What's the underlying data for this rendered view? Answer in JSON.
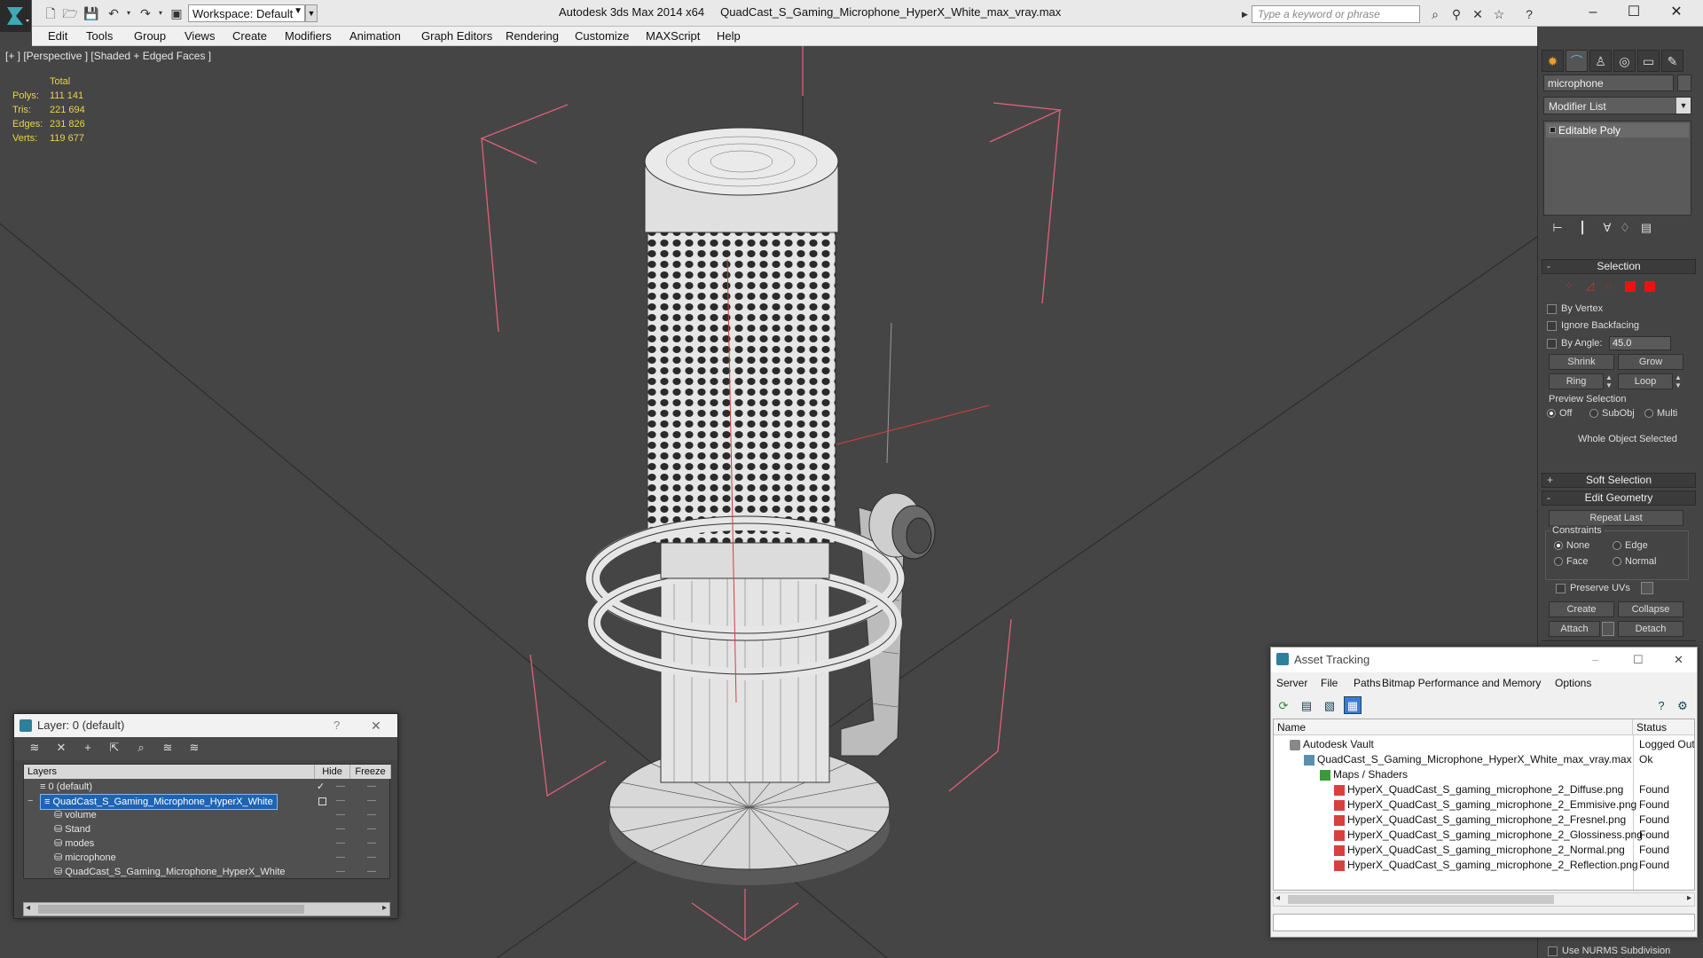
{
  "titlebar": {
    "workspace": "Workspace: Default",
    "app": "Autodesk 3ds Max  2014 x64",
    "file": "QuadCast_S_Gaming_Microphone_HyperX_White_max_vray.max",
    "search_placeholder": "Type a keyword or phrase"
  },
  "menus": [
    "Edit",
    "Tools",
    "Group",
    "Views",
    "Create",
    "Modifiers",
    "Animation",
    "Graph Editors",
    "Rendering",
    "Customize",
    "MAXScript",
    "Help"
  ],
  "viewport": {
    "label": "[+ ] [Perspective ] [Shaded + Edged Faces ]",
    "stats_header": "Total",
    "stats": [
      {
        "k": "Polys:",
        "v": "111 141"
      },
      {
        "k": "Tris:",
        "v": "221 694"
      },
      {
        "k": "Edges:",
        "v": "231 826"
      },
      {
        "k": "Verts:",
        "v": "119 677"
      }
    ],
    "stats_color": "#e8d44a",
    "bracket_color": "#e0607a"
  },
  "command_panel": {
    "object_name": "microphone",
    "modifier_list": "Modifier List",
    "stack_item": "Editable Poly",
    "selection": {
      "title": "Selection",
      "by_vertex": "By Vertex",
      "ignore_backfacing": "Ignore Backfacing",
      "by_angle": "By Angle:",
      "angle_value": "45.0",
      "shrink": "Shrink",
      "grow": "Grow",
      "ring": "Ring",
      "loop": "Loop",
      "preview_label": "Preview Selection",
      "preview_off": "Off",
      "preview_subobj": "SubObj",
      "preview_multi": "Multi",
      "status": "Whole Object Selected"
    },
    "soft_selection": "Soft Selection",
    "edit_geometry": {
      "title": "Edit Geometry",
      "repeat_last": "Repeat Last",
      "constraints": "Constraints",
      "none": "None",
      "edge": "Edge",
      "face": "Face",
      "normal": "Normal",
      "preserve_uvs": "Preserve UVs",
      "create": "Create",
      "collapse": "Collapse",
      "attach": "Attach",
      "detach": "Detach"
    },
    "nurms": "Use NURMS Subdivision"
  },
  "layer_dialog": {
    "title": "Layer: 0 (default)",
    "help": "?",
    "columns": {
      "layers": "Layers",
      "hide": "Hide",
      "freeze": "Freeze"
    },
    "rows": [
      {
        "name": "0 (default)",
        "indent": 1,
        "checked": true
      },
      {
        "name": "QuadCast_S_Gaming_Microphone_HyperX_White",
        "indent": 1,
        "selected": true
      },
      {
        "name": "volume",
        "indent": 2
      },
      {
        "name": "Stand",
        "indent": 2
      },
      {
        "name": "modes",
        "indent": 2
      },
      {
        "name": "microphone",
        "indent": 2
      },
      {
        "name": "QuadCast_S_Gaming_Microphone_HyperX_White",
        "indent": 2
      }
    ]
  },
  "asset_dialog": {
    "title": "Asset Tracking",
    "menu": [
      "Server",
      "File",
      "Paths",
      "Bitmap Performance and Memory",
      "Options"
    ],
    "columns": {
      "name": "Name",
      "status": "Status"
    },
    "rows": [
      {
        "name": "Autodesk Vault",
        "status": "Logged Out",
        "level": 0,
        "icon": "vault-icon"
      },
      {
        "name": "QuadCast_S_Gaming_Microphone_HyperX_White_max_vray.max",
        "status": "Ok",
        "level": 1,
        "icon": "max-file-icon"
      },
      {
        "name": "Maps / Shaders",
        "status": "",
        "level": 2,
        "icon": "maps-folder-icon"
      },
      {
        "name": "HyperX_QuadCast_S_gaming_microphone_2_Diffuse.png",
        "status": "Found",
        "level": 3,
        "icon": "png-icon"
      },
      {
        "name": "HyperX_QuadCast_S_gaming_microphone_2_Emmisive.png",
        "status": "Found",
        "level": 3,
        "icon": "png-icon"
      },
      {
        "name": "HyperX_QuadCast_S_gaming_microphone_2_Fresnel.png",
        "status": "Found",
        "level": 3,
        "icon": "png-icon"
      },
      {
        "name": "HyperX_QuadCast_S_gaming_microphone_2_Glossiness.png",
        "status": "Found",
        "level": 3,
        "icon": "png-icon"
      },
      {
        "name": "HyperX_QuadCast_S_gaming_microphone_2_Normal.png",
        "status": "Found",
        "level": 3,
        "icon": "png-icon"
      },
      {
        "name": "HyperX_QuadCast_S_gaming_microphone_2_Reflection.png",
        "status": "Found",
        "level": 3,
        "icon": "png-icon"
      }
    ]
  }
}
